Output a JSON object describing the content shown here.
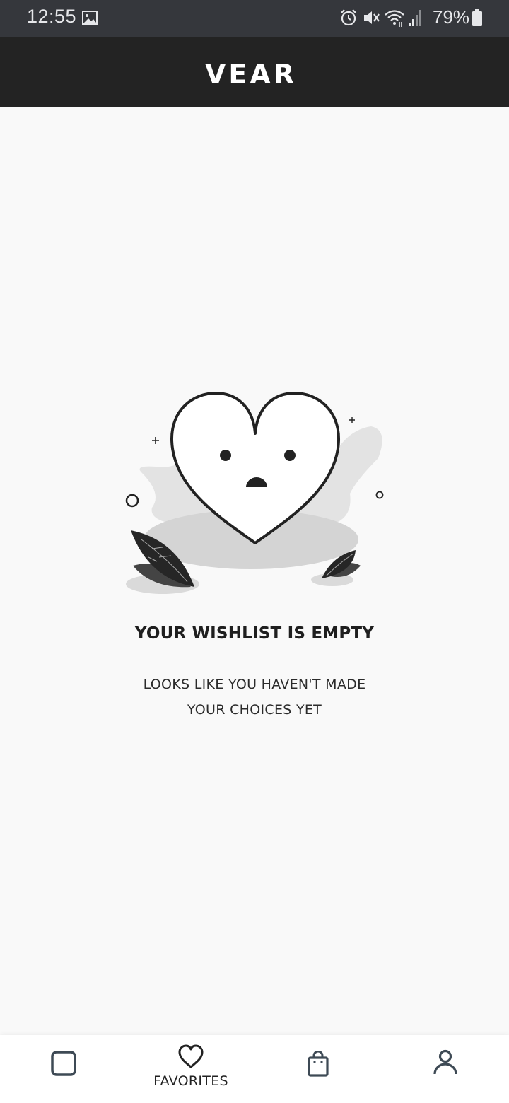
{
  "status_bar": {
    "time": "12:55",
    "battery": "79%",
    "icons": [
      "gallery-icon",
      "alarm-icon",
      "mute-icon",
      "wifi-icon",
      "signal-icon",
      "battery-icon"
    ]
  },
  "header": {
    "logo_text": "VEAR"
  },
  "empty_state": {
    "title": "YOUR WISHLIST IS EMPTY",
    "message_line1": "LOOKS LIKE YOU HAVEN'T MADE",
    "message_line2": "YOUR CHOICES YET",
    "illustration_icon": "sad-heart-illustration"
  },
  "bottom_nav": {
    "items": [
      {
        "icon": "square-icon",
        "label": ""
      },
      {
        "icon": "heart-icon",
        "label": "FAVORITES",
        "active": true
      },
      {
        "icon": "shopping-bag-icon",
        "label": ""
      },
      {
        "icon": "user-icon",
        "label": ""
      }
    ]
  },
  "colors": {
    "status_bar_bg": "#35373c",
    "header_bg": "#232323",
    "page_bg": "#f9f9f9",
    "nav_icon": "#3e4a55"
  }
}
